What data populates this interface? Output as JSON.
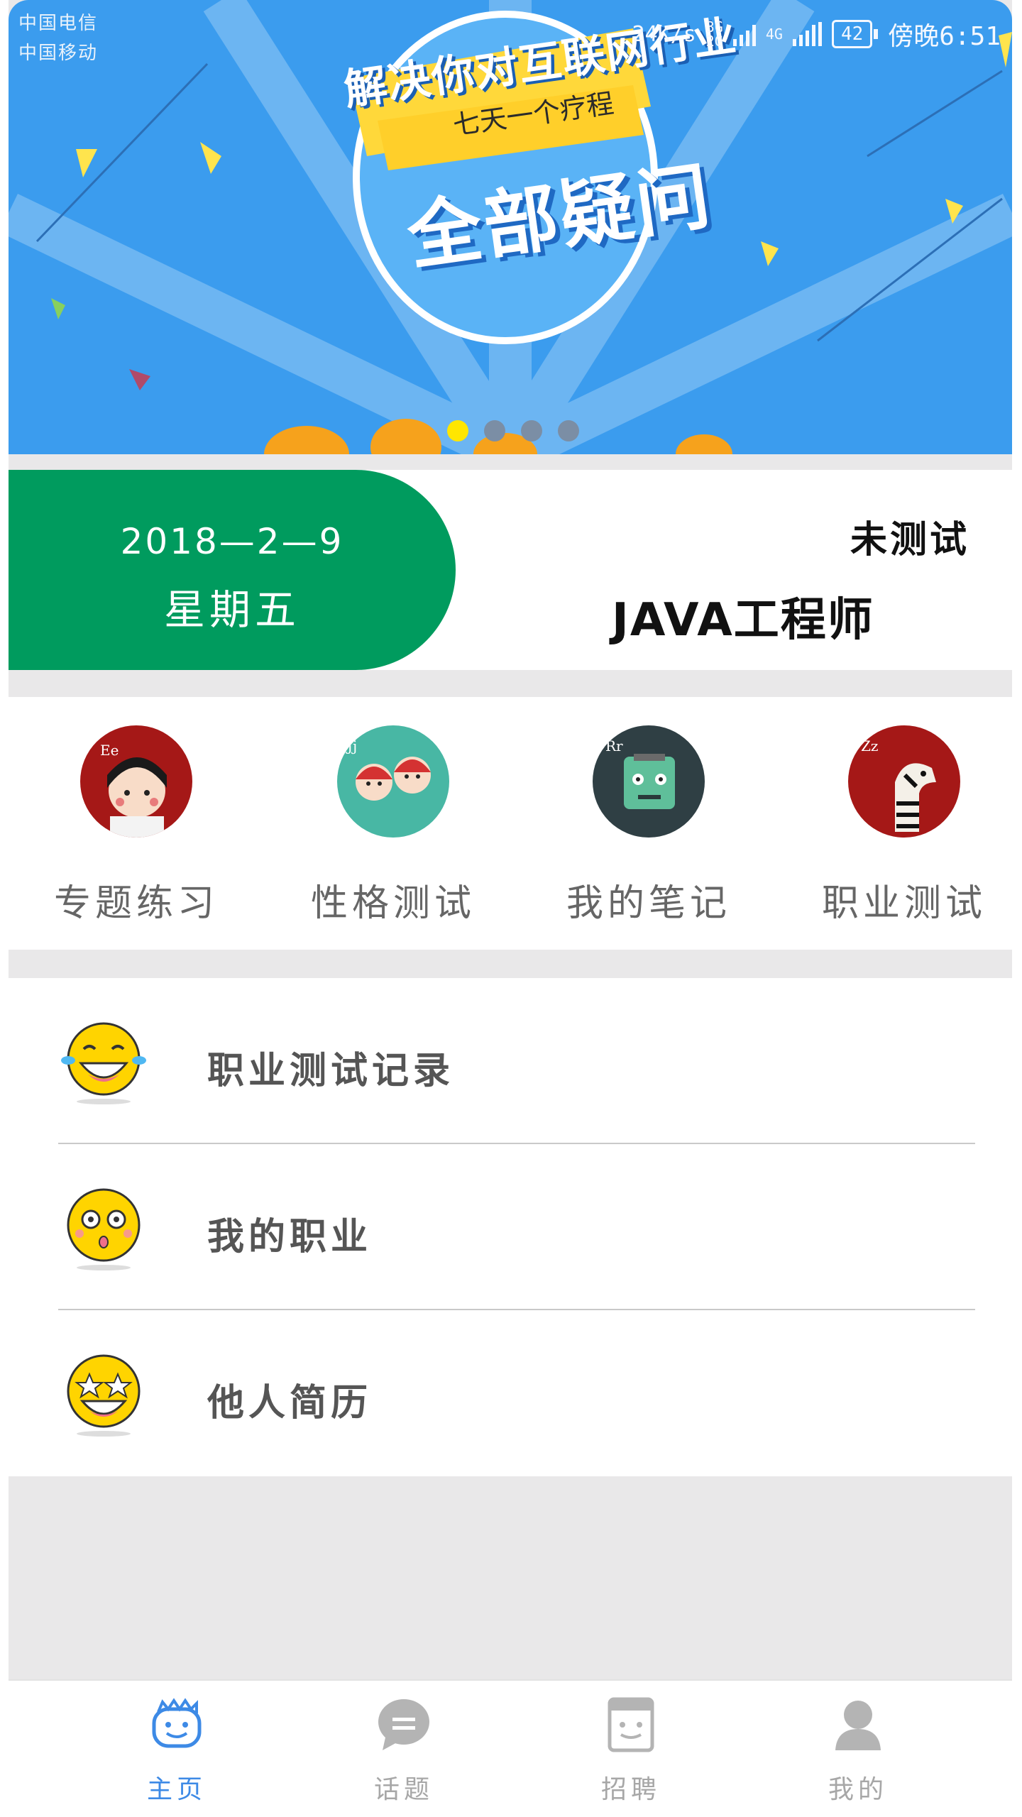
{
  "status_bar": {
    "carrier_1": "中国电信",
    "carrier_2": "中国移动",
    "net_speed": "24K/s",
    "net_type_top": "3G",
    "net_type_bottom": "2G",
    "net_type_2": "4G",
    "battery": "42",
    "time": "傍晚6:51"
  },
  "banner": {
    "headline": "解决你对互联网行业",
    "ribbon": "七天一个疗程",
    "big_text": "全部疑问",
    "slide_count": 4,
    "active_slide": 0,
    "colors": {
      "background": "#3b9cee",
      "active_dot": "#ffe600",
      "inactive_dot": "#7b8ea5"
    }
  },
  "date_card": {
    "date": "2018—2—9",
    "weekday": "星期五",
    "test_status": "未测试",
    "job": "JAVA工程师",
    "pill_color": "#009b5e"
  },
  "quick_menu": [
    {
      "label": "专题练习",
      "icon": "girl-avatar-icon",
      "color": "#a51817"
    },
    {
      "label": "性格测试",
      "icon": "twins-avatar-icon",
      "color": "#48b7a4"
    },
    {
      "label": "我的笔记",
      "icon": "robot-avatar-icon",
      "color": "#2f3f44"
    },
    {
      "label": "职业测试",
      "icon": "zebra-avatar-icon",
      "color": "#a51817"
    }
  ],
  "list": [
    {
      "label": "职业测试记录",
      "icon": "laughing-tears-emoji-icon"
    },
    {
      "label": "我的职业",
      "icon": "surprised-emoji-icon"
    },
    {
      "label": "他人简历",
      "icon": "star-eyes-emoji-icon"
    }
  ],
  "tabs": [
    {
      "label": "主页",
      "icon": "home-face-icon",
      "active": true
    },
    {
      "label": "话题",
      "icon": "chat-bubble-icon",
      "active": false
    },
    {
      "label": "招聘",
      "icon": "job-board-icon",
      "active": false
    },
    {
      "label": "我的",
      "icon": "person-icon",
      "active": false
    }
  ],
  "colors": {
    "accent": "#3d8ae6",
    "tab_inactive": "#a7a7a7"
  }
}
